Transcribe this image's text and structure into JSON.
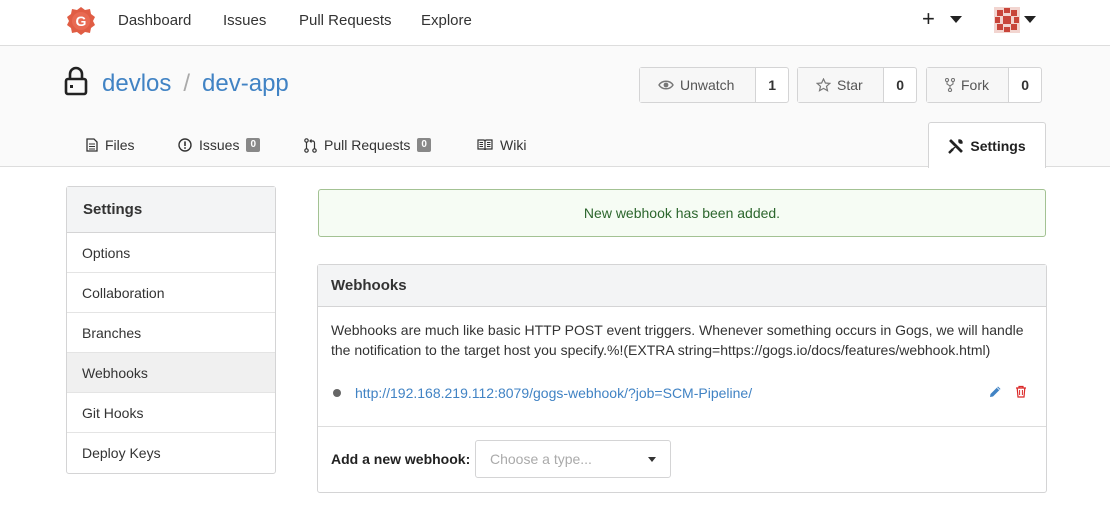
{
  "nav": {
    "links": [
      "Dashboard",
      "Issues",
      "Pull Requests",
      "Explore"
    ],
    "plus_label": "+"
  },
  "repo": {
    "owner": "devlos",
    "separator": "/",
    "name": "dev-app"
  },
  "actions": {
    "watch": {
      "label": "Unwatch",
      "count": "1"
    },
    "star": {
      "label": "Star",
      "count": "0"
    },
    "fork": {
      "label": "Fork",
      "count": "0"
    }
  },
  "tabs": {
    "files": "Files",
    "issues": {
      "label": "Issues",
      "count": "0"
    },
    "pulls": {
      "label": "Pull Requests",
      "count": "0"
    },
    "wiki": "Wiki",
    "settings": "Settings"
  },
  "sidebar": {
    "title": "Settings",
    "items": [
      "Options",
      "Collaboration",
      "Branches",
      "Webhooks",
      "Git Hooks",
      "Deploy Keys"
    ],
    "active": "Webhooks"
  },
  "flash": "New webhook has been added.",
  "webhooks": {
    "title": "Webhooks",
    "description_line1": "Webhooks are much like basic HTTP POST event triggers. Whenever something occurs in Gogs, we will handle",
    "description_line2": "the notification to the target host you specify.%!(EXTRA string=https://gogs.io/docs/features/webhook.html)",
    "hook_url": "http://192.168.219.112:8079/gogs-webhook/?job=SCM-Pipeline/",
    "add_label": "Add a new webhook:",
    "type_placeholder": "Choose a type..."
  },
  "colors": {
    "link": "#4183c4",
    "logo": "#e05d44",
    "delete": "#db2828",
    "success_bg": "#f6fcf4",
    "success_text": "#2c662d"
  }
}
